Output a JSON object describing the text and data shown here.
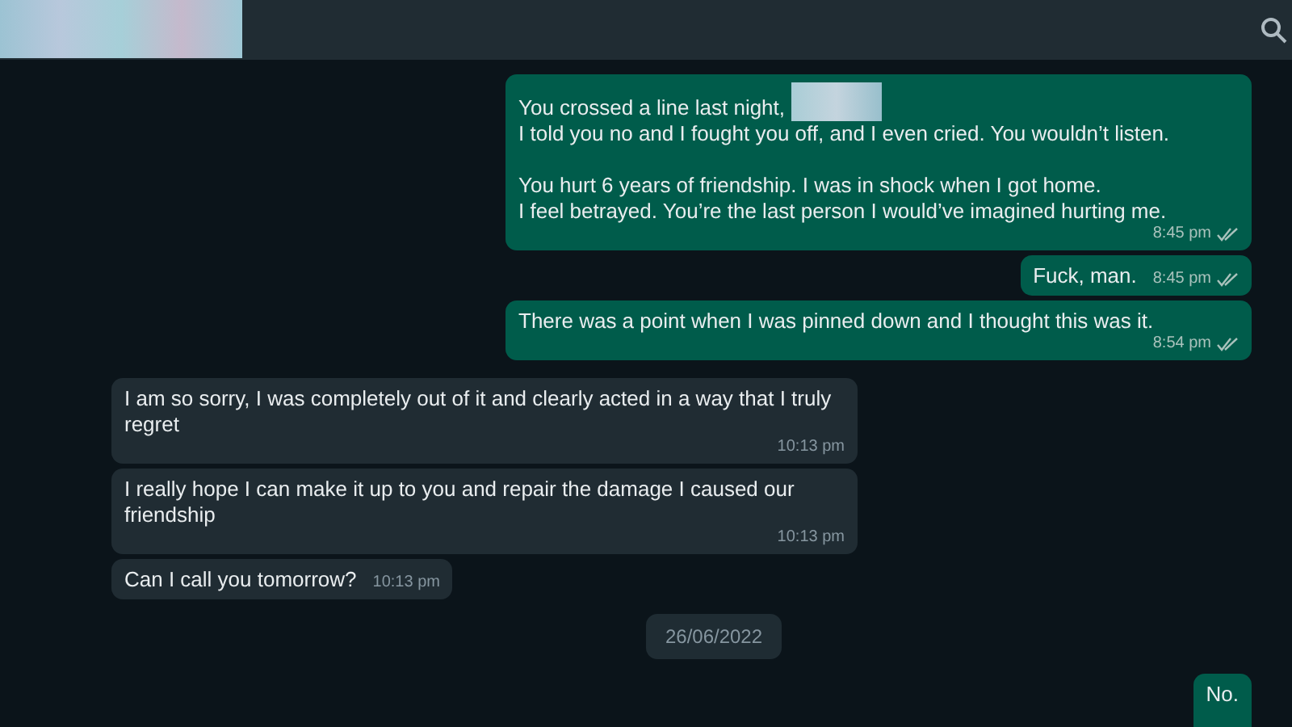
{
  "messages": [
    {
      "kind": "outgoing",
      "parts": [
        {
          "kind": "text",
          "text": "You crossed a line last night, "
        },
        {
          "kind": "redacted"
        },
        {
          "kind": "text",
          "text": "\nI told you no and I fought you off, and I even cried. You wouldn’t listen.\n\nYou hurt 6 years of friendship. I was in shock when I got home.\nI feel betrayed. You’re the last person I would’ve imagined hurting me."
        }
      ],
      "time": "8:45 pm",
      "read": false
    },
    {
      "kind": "outgoing",
      "parts": [
        {
          "kind": "text",
          "text": "Fuck, man."
        }
      ],
      "time": "8:45 pm",
      "read": false
    },
    {
      "kind": "outgoing",
      "parts": [
        {
          "kind": "text",
          "text": "There was a point when I was pinned down and I thought this was it."
        }
      ],
      "time": "8:54 pm",
      "read": false
    },
    {
      "kind": "incoming",
      "parts": [
        {
          "kind": "text",
          "text": "I am so sorry, I was completely out of it and clearly acted in a way that I truly regret"
        }
      ],
      "time": "10:13 pm"
    },
    {
      "kind": "incoming",
      "parts": [
        {
          "kind": "text",
          "text": "I really hope I can make it up to you and repair the damage I caused our friendship"
        }
      ],
      "time": "10:13 pm"
    },
    {
      "kind": "incoming",
      "parts": [
        {
          "kind": "text",
          "text": "Can I call you tomorrow?"
        }
      ],
      "time": "10:13 pm"
    },
    {
      "kind": "date",
      "text": "26/06/2022"
    },
    {
      "kind": "outgoing",
      "parts": [
        {
          "kind": "text",
          "text": "No."
        }
      ]
    }
  ]
}
